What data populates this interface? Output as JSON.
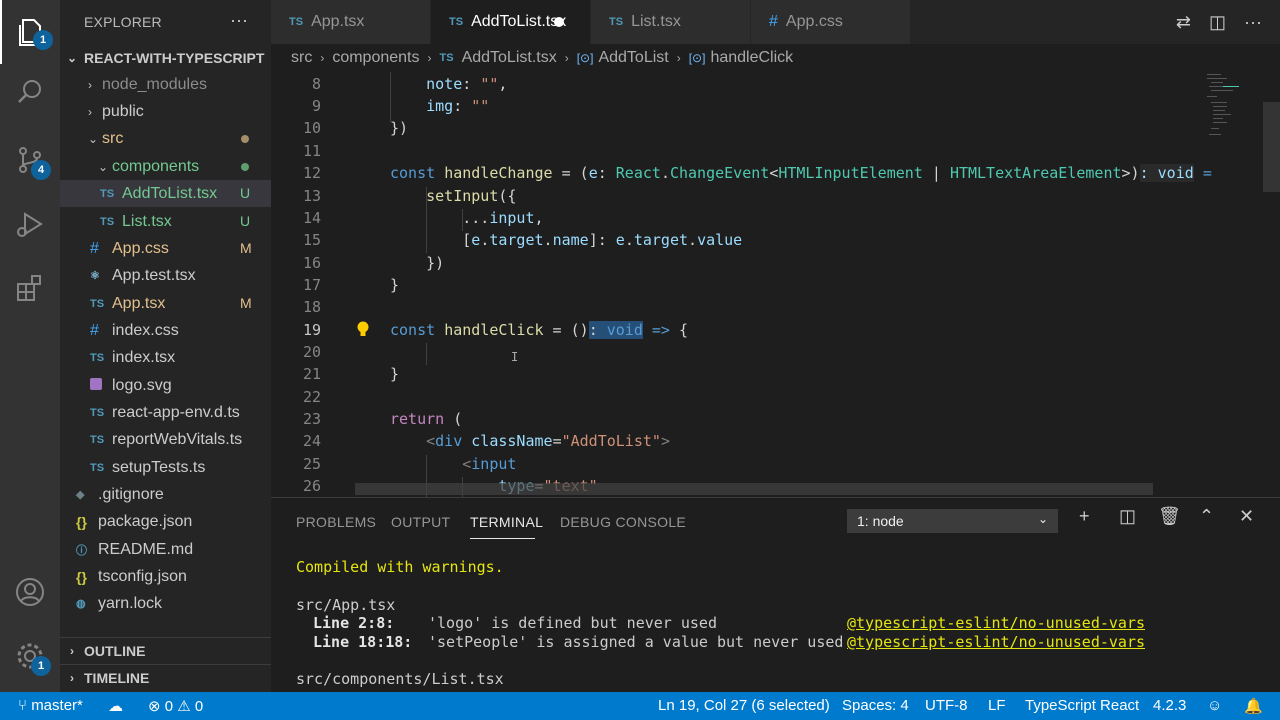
{
  "activity": {
    "explorer_badge": "1",
    "scm_badge": "4",
    "settings_badge": "1"
  },
  "sidebar": {
    "title": "EXPLORER",
    "more": "···",
    "project": "REACT-WITH-TYPESCRIPT",
    "outline": "OUTLINE",
    "timeline": "TIMELINE",
    "items": [
      {
        "label": "node_modules"
      },
      {
        "label": "public"
      },
      {
        "label": "src"
      },
      {
        "label": "components"
      },
      {
        "label": "AddToList.tsx",
        "status": "U",
        "icon": "TS"
      },
      {
        "label": "List.tsx",
        "status": "U",
        "icon": "TS"
      },
      {
        "label": "App.css",
        "status": "M",
        "icon": "#"
      },
      {
        "label": "App.test.tsx"
      },
      {
        "label": "App.tsx",
        "status": "M",
        "icon": "TS"
      },
      {
        "label": "index.css",
        "icon": "#"
      },
      {
        "label": "index.tsx",
        "icon": "TS"
      },
      {
        "label": "logo.svg"
      },
      {
        "label": "react-app-env.d.ts",
        "icon": "TS"
      },
      {
        "label": "reportWebVitals.ts",
        "icon": "TS"
      },
      {
        "label": "setupTests.ts",
        "icon": "TS"
      },
      {
        "label": ".gitignore"
      },
      {
        "label": "package.json",
        "icon": "{}"
      },
      {
        "label": "README.md"
      },
      {
        "label": "tsconfig.json",
        "icon": "{}"
      },
      {
        "label": "yarn.lock"
      }
    ],
    "colors": {
      "untracked": "#73c991",
      "modified": "#e2c08d",
      "default": "#cccccc"
    }
  },
  "tabs": [
    {
      "icon": "TS",
      "label": "App.tsx"
    },
    {
      "icon": "TS",
      "label": "AddToList.tsx"
    },
    {
      "icon": "TS",
      "label": "List.tsx"
    },
    {
      "icon": "#",
      "label": "App.css"
    }
  ],
  "breadcrumb": [
    "src",
    "components",
    "AddToList.tsx",
    "AddToList",
    "handleClick"
  ],
  "editor": {
    "line_numbers": [
      "8",
      "9",
      "10",
      "11",
      "12",
      "13",
      "14",
      "15",
      "16",
      "17",
      "18",
      "19",
      "20",
      "21",
      "22",
      "23",
      "24",
      "25",
      "26"
    ],
    "current_line": "19"
  },
  "panel": {
    "tabs": [
      "PROBLEMS",
      "OUTPUT",
      "TERMINAL",
      "DEBUG CONSOLE"
    ],
    "terminal_select": "1: node",
    "lines": {
      "compiled": "Compiled with warnings.",
      "file1": "src/App.tsx",
      "w1_loc": "Line 2:8:",
      "w1_msg": "'logo' is defined but never used",
      "w1_rule": "@typescript-eslint/no-unused-vars",
      "w2_loc": "Line 18:18:",
      "w2_msg": "'setPeople' is assigned a value but never used",
      "w2_rule": "@typescript-eslint/no-unused-vars",
      "file2": "src/components/List.tsx"
    }
  },
  "status": {
    "branch": "master*",
    "errors": "0",
    "warnings": "0",
    "position": "Ln 19, Col 27 (6 selected)",
    "spaces": "Spaces: 4",
    "encoding": "UTF-8",
    "eol": "LF",
    "language": "TypeScript React",
    "version": "4.2.3"
  }
}
